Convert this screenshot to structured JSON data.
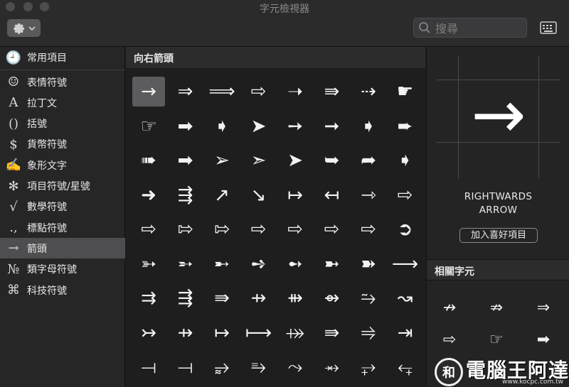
{
  "window": {
    "title": "字元檢視器"
  },
  "toolbar": {
    "search_placeholder": "搜尋"
  },
  "sidebar": {
    "items": [
      {
        "icon": "clock-icon",
        "glyph": "🕘",
        "label": "常用項目"
      },
      {
        "icon": "smiley-icon",
        "glyph": "☺",
        "label": "表情符號"
      },
      {
        "icon": "letter-a-icon",
        "glyph": "A",
        "label": "拉丁文"
      },
      {
        "icon": "parentheses-icon",
        "glyph": "()",
        "label": "括號"
      },
      {
        "icon": "dollar-icon",
        "glyph": "$",
        "label": "貨幣符號"
      },
      {
        "icon": "pictograph-icon",
        "glyph": "✍",
        "label": "象形文字"
      },
      {
        "icon": "asterisk-icon",
        "glyph": "✻",
        "label": "項目符號/星號"
      },
      {
        "icon": "square-root-icon",
        "glyph": "√",
        "label": "數學符號"
      },
      {
        "icon": "punctuation-icon",
        "glyph": ".,",
        "label": "標點符號"
      },
      {
        "icon": "arrow-icon",
        "glyph": "→",
        "label": "箭頭"
      },
      {
        "icon": "numero-icon",
        "glyph": "№",
        "label": "類字母符號"
      },
      {
        "icon": "command-icon",
        "glyph": "⌘",
        "label": "科技符號"
      }
    ],
    "selected_index": 9
  },
  "main": {
    "section_title": "向右箭頭",
    "glyphs": [
      "→",
      "⇒",
      "⟹",
      "⇨",
      "➝",
      "⇛",
      "⇢",
      "☛",
      "☞",
      "➡",
      "➧",
      "➤",
      "➙",
      "➞",
      "➧",
      "➨",
      "➠",
      "➡",
      "➢",
      "➣",
      "➤",
      "➥",
      "➦",
      "➧",
      "➜",
      "⇶",
      "↗",
      "↘",
      "↦",
      "↤",
      "⇾",
      "⇨",
      "⇨",
      "⇰",
      "⇰",
      "⇨",
      "⇨",
      "⇨",
      "⇨",
      "➲",
      "➳",
      "➵",
      "➸",
      "➺",
      "➻",
      "➼",
      "➽",
      "⟶",
      "⇉",
      "⇶",
      "⇛",
      "⇸",
      "⇻",
      "⇴",
      "⥲",
      "↝",
      "↣",
      "⇸",
      "↦",
      "⟼",
      "⤀",
      "⇛",
      "⥤",
      "⇥",
      "⟞",
      "⟞",
      "⥵",
      "⥱",
      "⤳",
      "⥇",
      "⥅",
      "⥆"
    ],
    "selected_index": 0
  },
  "detail": {
    "glyph": "→",
    "name_line1": "RIGHTWARDS",
    "name_line2": "ARROW",
    "favorite_button": "加入喜好項目",
    "related_title": "相關字元",
    "related": [
      "↛",
      "⇏",
      "⇒",
      "⇨",
      "☞",
      "➡"
    ]
  },
  "watermark": {
    "circle_text": "和",
    "text": "電腦王阿達",
    "url": "www.kocpc.com.tw"
  }
}
